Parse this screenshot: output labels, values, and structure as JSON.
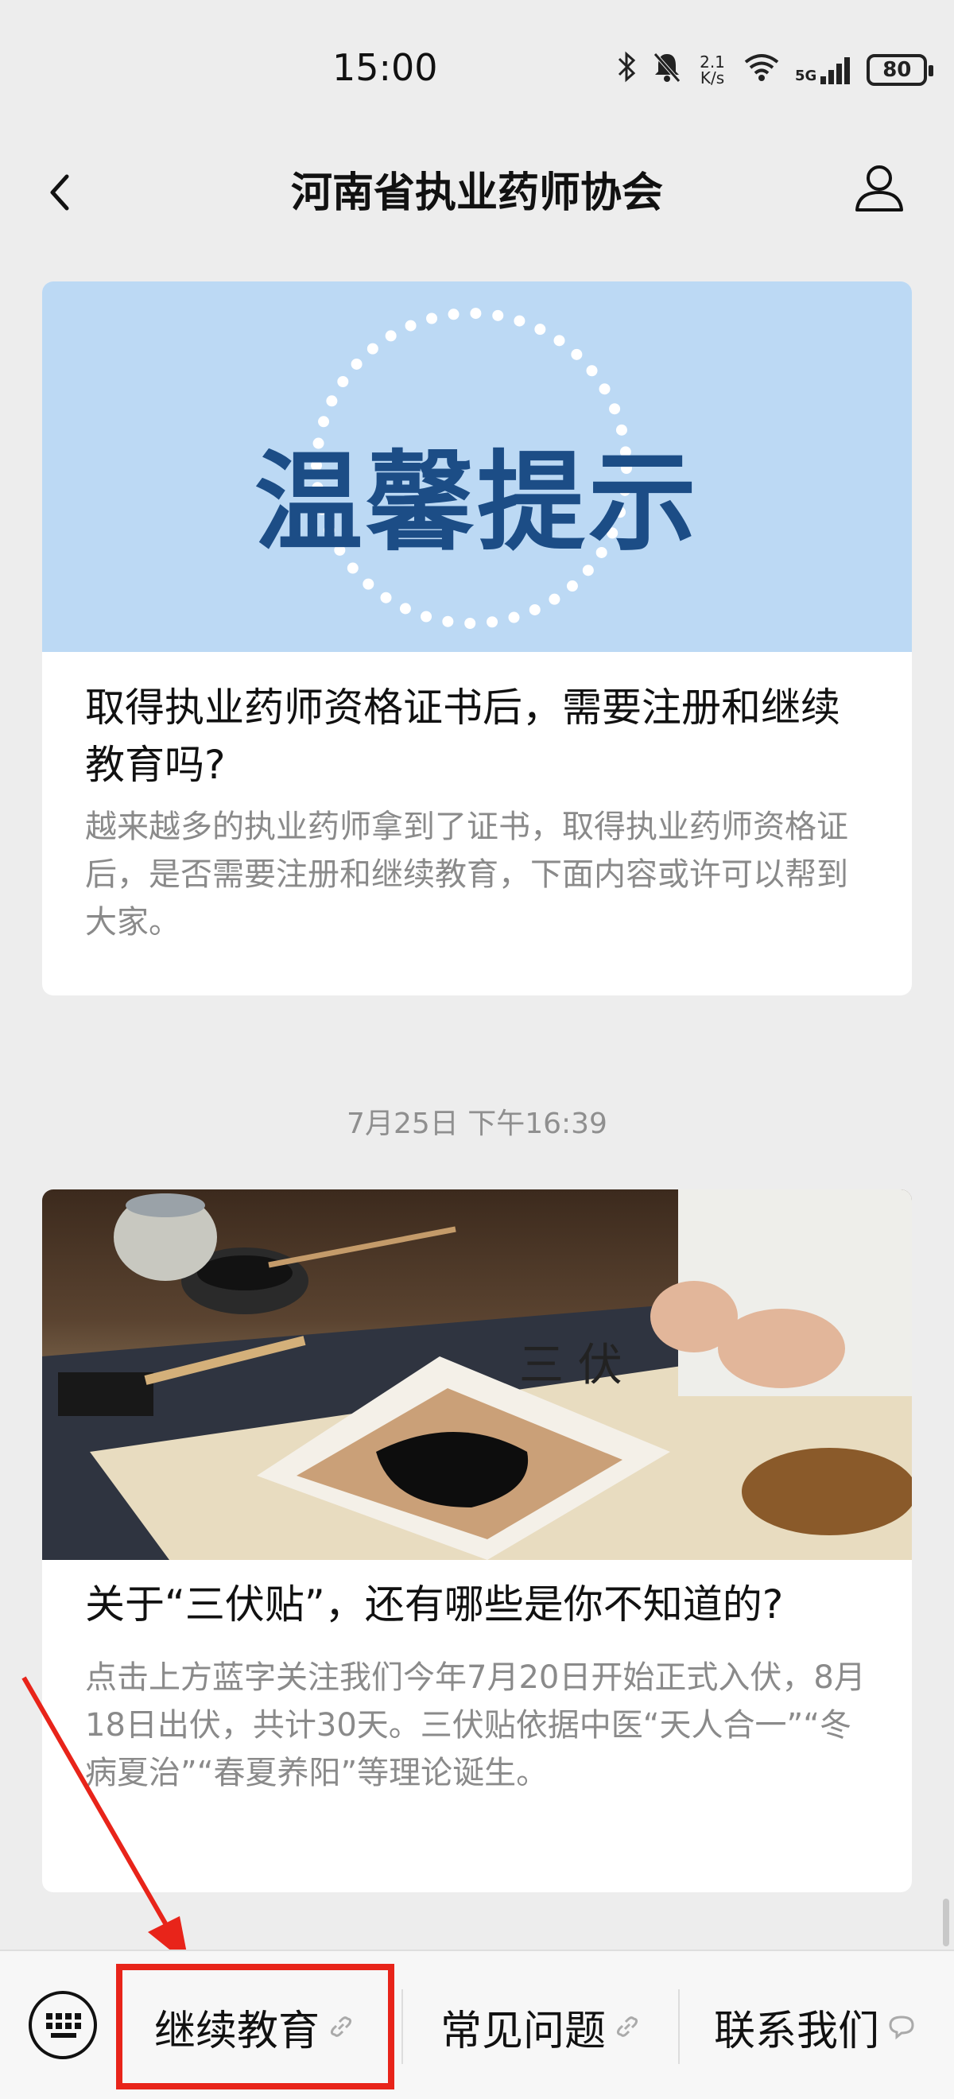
{
  "status_bar": {
    "time": "15:00",
    "net_speed": "2.1\nK/s",
    "signal": "5G",
    "battery": "80"
  },
  "nav": {
    "title": "河南省执业药师协会"
  },
  "articles": [
    {
      "banner_text": "温馨提示",
      "title": "取得执业药师资格证书后，需要注册和继续教育吗?",
      "desc": "越来越多的执业药师拿到了证书，取得执业药师资格证后，是否需要注册和继续教育，下面内容或许可以帮到大家。"
    },
    {
      "title": "关于“三伏贴”，还有哪些是你不知道的?",
      "desc": "点击上方蓝字关注我们今年7月20日开始正式入伏，8月18日出伏，共计30天。三伏贴依据中医“天人合一”“冬病夏治”“春夏养阳”等理论诞生。"
    }
  ],
  "timestamp": "7月25日 下午16:39",
  "menu": {
    "items": [
      {
        "label": "继续教育",
        "icon": "link-icon"
      },
      {
        "label": "常见问题",
        "icon": "link-icon"
      },
      {
        "label": "联系我们",
        "icon": "chat-bubble-icon"
      }
    ]
  },
  "colors": {
    "background": "#ededed",
    "banner_bg": "#bcd9f4",
    "banner_text": "#1c4d86",
    "highlight": "#e8241a"
  }
}
